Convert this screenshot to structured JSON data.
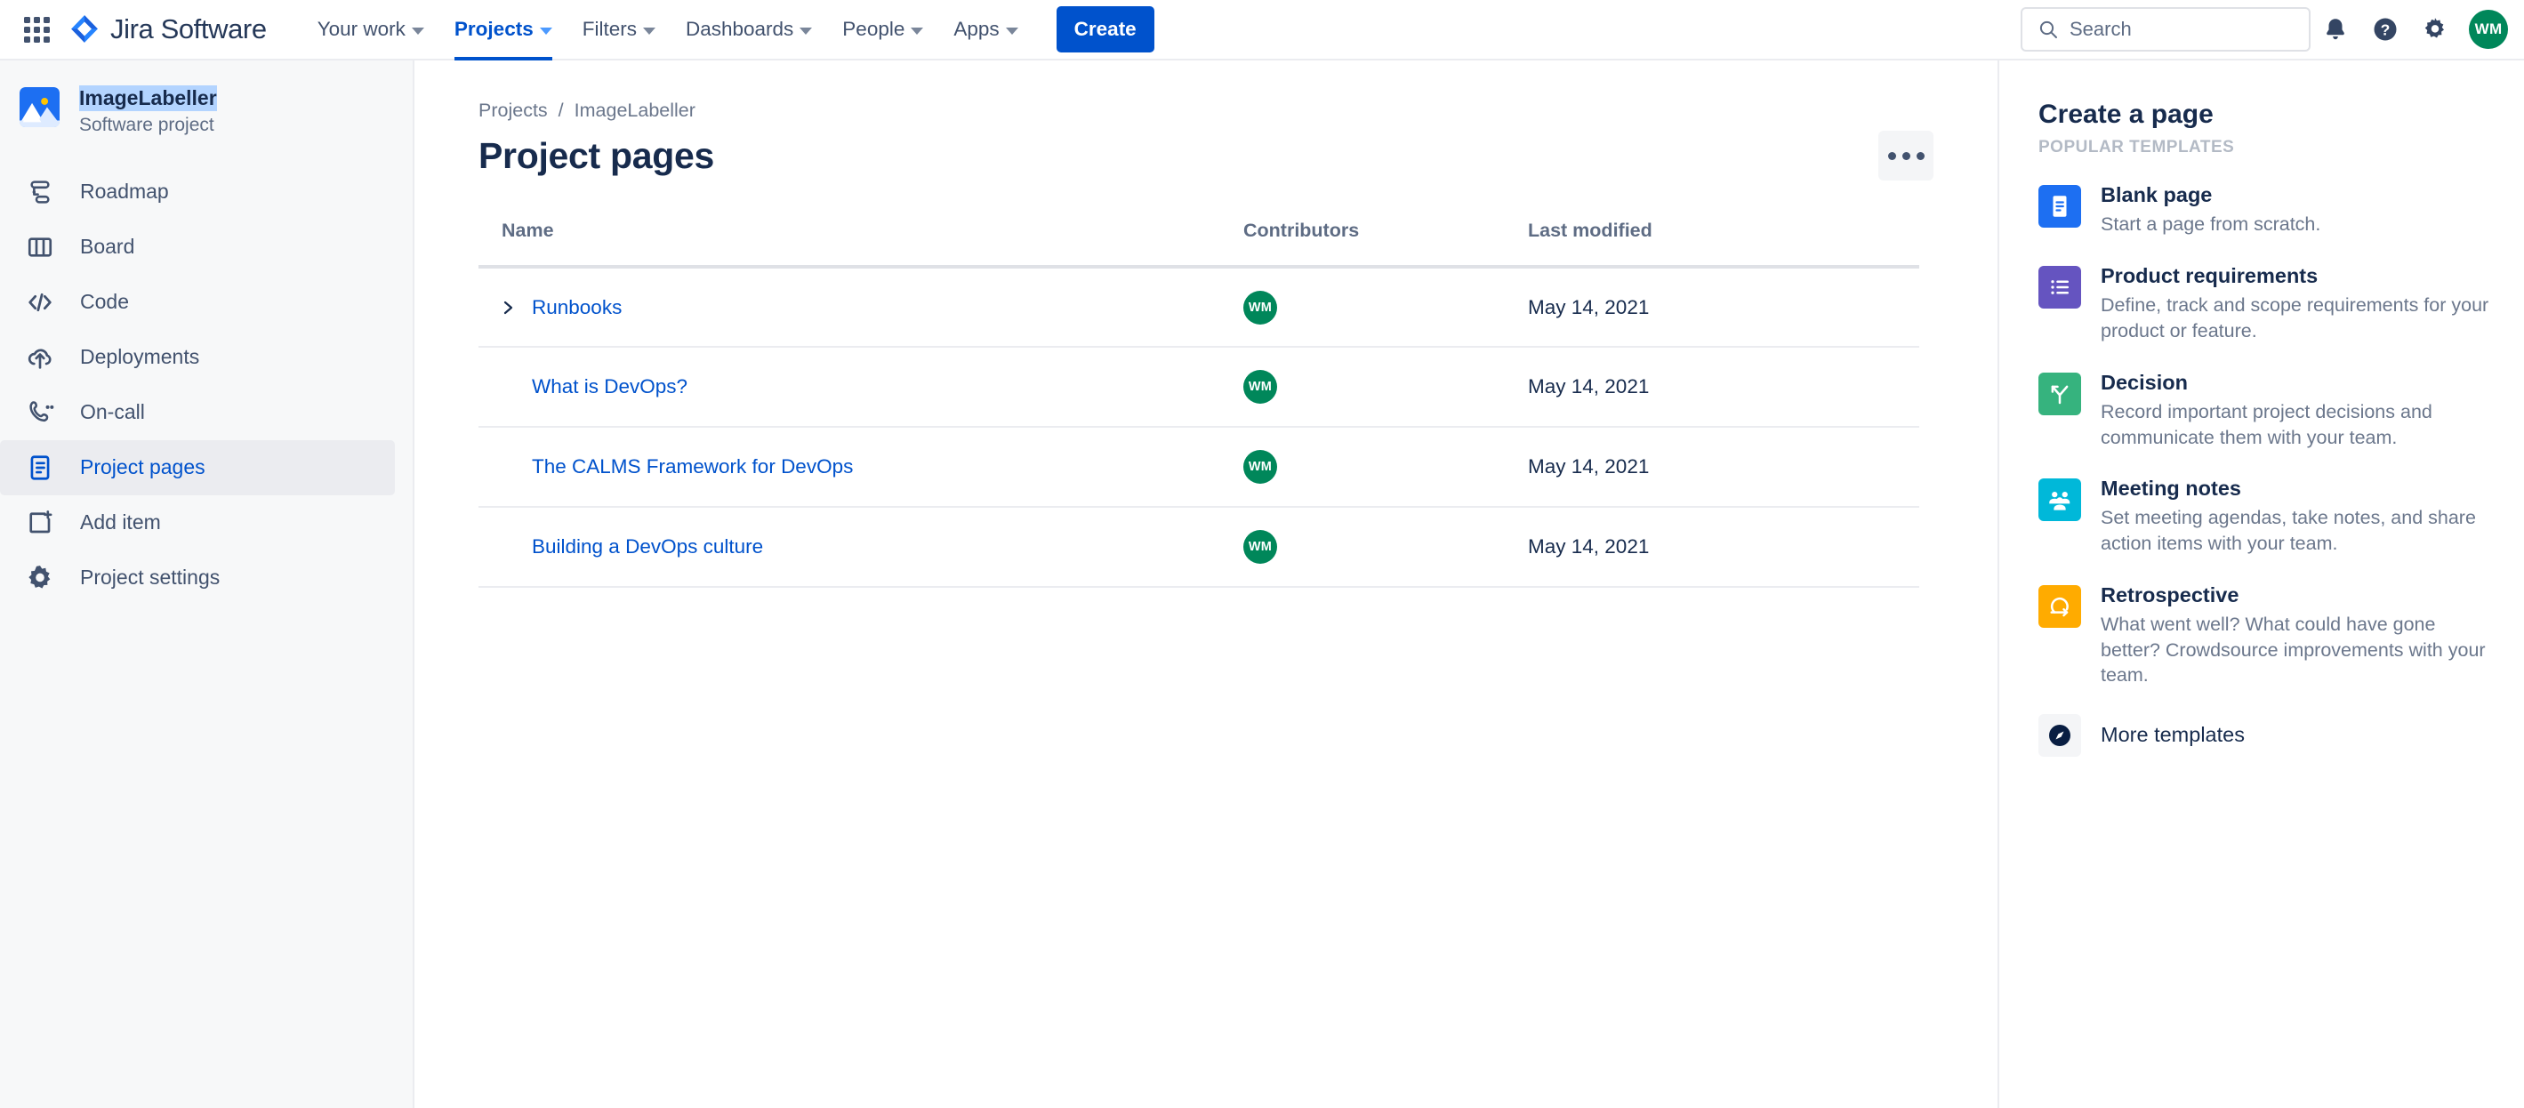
{
  "topnav": {
    "appswitcher_label": "apps-grid",
    "brand": "Jira Software",
    "items": [
      {
        "label": "Your work",
        "active": false
      },
      {
        "label": "Projects",
        "active": true
      },
      {
        "label": "Filters",
        "active": false
      },
      {
        "label": "Dashboards",
        "active": false
      },
      {
        "label": "People",
        "active": false
      },
      {
        "label": "Apps",
        "active": false
      }
    ],
    "create_label": "Create",
    "search": {
      "value": "",
      "placeholder": "Search"
    },
    "avatar_initials": "WM"
  },
  "sidebar": {
    "project_name": "ImageLabeller",
    "project_type": "Software project",
    "items": [
      {
        "label": "Roadmap",
        "icon": "roadmap-icon",
        "selected": false
      },
      {
        "label": "Board",
        "icon": "board-icon",
        "selected": false
      },
      {
        "label": "Code",
        "icon": "code-icon",
        "selected": false
      },
      {
        "label": "Deployments",
        "icon": "deployments-icon",
        "selected": false
      },
      {
        "label": "On-call",
        "icon": "on-call-icon",
        "selected": false
      },
      {
        "label": "Project pages",
        "icon": "pages-icon",
        "selected": true
      },
      {
        "label": "Add item",
        "icon": "add-item-icon",
        "selected": false
      },
      {
        "label": "Project settings",
        "icon": "settings-icon",
        "selected": false
      }
    ]
  },
  "main": {
    "breadcrumb": {
      "root": "Projects",
      "separator": "/",
      "current": "ImageLabeller"
    },
    "page_title": "Project pages",
    "table": {
      "headers": {
        "name": "Name",
        "contributors": "Contributors",
        "last_modified": "Last modified"
      },
      "rows": [
        {
          "name": "Runbooks",
          "expandable": true,
          "contributor": "WM",
          "last_modified": "May 14, 2021"
        },
        {
          "name": "What is DevOps?",
          "expandable": false,
          "contributor": "WM",
          "last_modified": "May 14, 2021"
        },
        {
          "name": "The CALMS Framework for DevOps",
          "expandable": false,
          "contributor": "WM",
          "last_modified": "May 14, 2021"
        },
        {
          "name": "Building a DevOps culture",
          "expandable": false,
          "contributor": "WM",
          "last_modified": "May 14, 2021"
        }
      ]
    }
  },
  "right_panel": {
    "title": "Create a page",
    "subtitle": "POPULAR TEMPLATES",
    "templates": [
      {
        "name": "Blank page",
        "desc": "Start a page from scratch.",
        "icon": "blank-page-icon",
        "color": "#1d6ff2"
      },
      {
        "name": "Product requirements",
        "desc": "Define, track and scope requirements for your product or feature.",
        "icon": "requirements-icon",
        "color": "#6554c0"
      },
      {
        "name": "Decision",
        "desc": "Record important project decisions and communicate them with your team.",
        "icon": "decision-icon",
        "color": "#36b37e"
      },
      {
        "name": "Meeting notes",
        "desc": "Set meeting agendas, take notes, and share action items with your team.",
        "icon": "meeting-notes-icon",
        "color": "#00b8d9"
      },
      {
        "name": "Retrospective",
        "desc": "What went well? What could have gone better? Crowdsource improvements with your team.",
        "icon": "retrospective-icon",
        "color": "#ffab00"
      }
    ],
    "more_templates": "More templates"
  },
  "colors": {
    "brand_blue": "#0052cc",
    "link_blue": "#0052cc",
    "avatar_green": "#00875a",
    "text_dark": "#172b4d",
    "text_muted": "#6b778c",
    "border": "#ebecf0"
  }
}
